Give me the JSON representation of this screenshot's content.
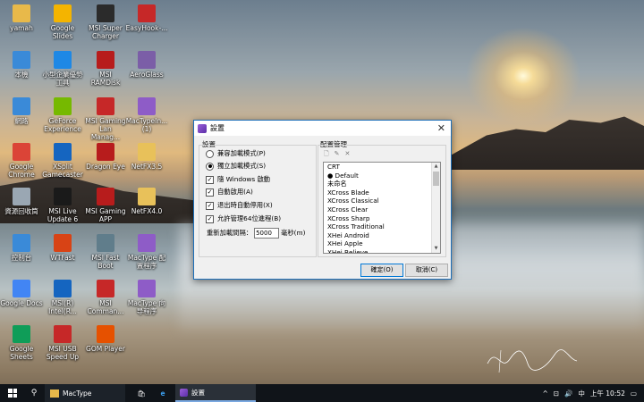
{
  "desktop": {
    "icons": [
      {
        "label": "yamah",
        "icon": "folder-icon",
        "color": "#e8b94a"
      },
      {
        "label": "Google Slides",
        "icon": "google-slides-icon",
        "color": "#f4b400"
      },
      {
        "label": "MSI Super Charger",
        "icon": "msi-super-charger-icon",
        "color": "#2b2b2b"
      },
      {
        "label": "EasyHook-...",
        "icon": "easyhook-icon",
        "color": "#c62828"
      },
      {
        "label": "本機",
        "icon": "this-pc-icon",
        "color": "#3a8ad8"
      },
      {
        "label": "小型企業優勢工具",
        "icon": "small-business-tool-icon",
        "color": "#1e88e5"
      },
      {
        "label": "MSI RAMDisk",
        "icon": "msi-ramdisk-icon",
        "color": "#b71c1c"
      },
      {
        "label": "AeroGlass",
        "icon": "aeroglass-icon",
        "color": "#7b5ea7"
      },
      {
        "label": "網路",
        "icon": "network-icon",
        "color": "#3a8ad8"
      },
      {
        "label": "GeForce Experience",
        "icon": "geforce-icon",
        "color": "#76b900"
      },
      {
        "label": "MSI Gaming Lan Manag...",
        "icon": "msi-gaming-lan-icon",
        "color": "#c62828"
      },
      {
        "label": "MacTypeIn... (1)",
        "icon": "mactype-installer-icon",
        "color": "#8e5cc7"
      },
      {
        "label": "Google Chrome",
        "icon": "chrome-icon",
        "color": "#db4437"
      },
      {
        "label": "XSplit Gamecaster",
        "icon": "xsplit-icon",
        "color": "#1565c0"
      },
      {
        "label": "Dragon Eye",
        "icon": "dragon-eye-icon",
        "color": "#b71c1c"
      },
      {
        "label": "NetFX3.5",
        "icon": "folder-icon",
        "color": "#e8c15a"
      },
      {
        "label": "資源回收筒",
        "icon": "recycle-bin-icon",
        "color": "#9aa7b3"
      },
      {
        "label": "MSI Live Update 6",
        "icon": "msi-live-update-icon",
        "color": "#1a1a1a"
      },
      {
        "label": "MSI Gaming APP",
        "icon": "msi-gaming-app-icon",
        "color": "#b71c1c"
      },
      {
        "label": "NetFX4.0",
        "icon": "folder-icon",
        "color": "#e8c15a"
      },
      {
        "label": "控制台",
        "icon": "control-panel-icon",
        "color": "#3a8ad8"
      },
      {
        "label": "WTFast",
        "icon": "wtfast-icon",
        "color": "#d84315"
      },
      {
        "label": "MSI Fast Boot",
        "icon": "msi-fast-boot-icon",
        "color": "#607d8b"
      },
      {
        "label": "MacType 配置程序",
        "icon": "mactype-config-icon",
        "color": "#8e5cc7"
      },
      {
        "label": "Google Docs",
        "icon": "google-docs-icon",
        "color": "#4285f4"
      },
      {
        "label": "MSI(R) Intel(R...",
        "icon": "msi-intel-icon",
        "color": "#1565c0"
      },
      {
        "label": "MSI Comman...",
        "icon": "msi-command-center-icon",
        "color": "#c62828"
      },
      {
        "label": "MacType 向导程序",
        "icon": "mactype-wizard-icon",
        "color": "#8e5cc7"
      },
      {
        "label": "Google Sheets",
        "icon": "google-sheets-icon",
        "color": "#0f9d58"
      },
      {
        "label": "MSI USB Speed Up",
        "icon": "msi-usb-speed-up-icon",
        "color": "#c62828"
      },
      {
        "label": "GOM Player",
        "icon": "gom-player-icon",
        "color": "#e65100"
      }
    ]
  },
  "dialog": {
    "title": "設置",
    "settings_group_label": "設置",
    "options": {
      "compat_mode": "兼容加載模式(P)",
      "standalone_mode": "獨立加載模式(S)",
      "start_with_windows": "隨 Windows 啟動",
      "auto_enable": "自動啟用(A)",
      "auto_disable_on_exit": "退出時自動停用(X)",
      "allow_64bit": "允許管理64位進程(B)",
      "reload_interval_label": "重新加載間隔：",
      "reload_interval_value": "5000",
      "reload_interval_unit": "毫秒(m)"
    },
    "config_group_label": "配置管理",
    "profiles": [
      "CRT",
      "● Default",
      "未命名",
      "XCross Blade",
      "XCross Classical",
      "XCross Clear",
      "XCross Sharp",
      "XCross Traditional",
      "XHei Android",
      "XHei Apple",
      "XHei Believe"
    ],
    "ok_button": "確定(O)",
    "cancel_button": "取消(C)"
  },
  "taskbar": {
    "app_label": "MacType",
    "active_window_label": "設置",
    "ime": "中",
    "time": "上午 10:52"
  }
}
